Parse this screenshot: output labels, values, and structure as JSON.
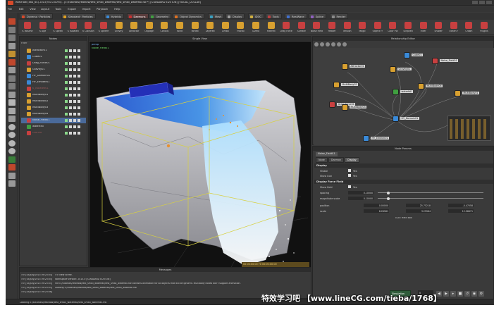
{
  "window": {
    "title": "RealFlow (x64_64) 2015(9.0.0.0095) - [E:/tutorials/realflow/test_small_waterfall/test_small_waterfall.flw *] [STANDARD EDITION] [VISUAL_DOLLAR]"
  },
  "menu": [
    "File",
    "Edit",
    "View",
    "Layout",
    "Tools",
    "Export",
    "Import",
    "Playback",
    "Help"
  ],
  "tabs": [
    {
      "label": "Dyverso · Particles",
      "color": "#d84a2a"
    },
    {
      "label": "Standard · Particles",
      "color": "#e0a020"
    },
    {
      "label": "Hybrido",
      "color": "#3a8ad8"
    },
    {
      "label": "Daemons",
      "color": "#c83030",
      "active": true
    },
    {
      "label": "Geometry",
      "color": "#40a040"
    },
    {
      "label": "Object Dynamics",
      "color": "#e07020"
    },
    {
      "label": "Mesh",
      "color": "#3aa0c0"
    },
    {
      "label": "Display",
      "color": "#a0a0a0"
    },
    {
      "label": "IDOC",
      "color": "#d0b040"
    },
    {
      "label": "Tools",
      "color": "#c04040"
    },
    {
      "label": "RealWave",
      "color": "#4070d0"
    },
    {
      "label": "Spline",
      "color": "#9060c0"
    },
    {
      "label": "Render",
      "color": "#8a8a8a"
    }
  ],
  "shelf": [
    {
      "label": "K Volume",
      "color": "#c84040"
    },
    {
      "label": "K Age",
      "color": "#c84040"
    },
    {
      "label": "K Speed",
      "color": "#c84040"
    },
    {
      "label": "K Isolated",
      "color": "#c84040"
    },
    {
      "label": "K Collision",
      "color": "#c84040"
    },
    {
      "label": "K Sphere",
      "color": "#c84040"
    },
    {
      "label": "Gravity",
      "color": "#d8a030"
    },
    {
      "label": "Attractor",
      "color": "#d8a030"
    },
    {
      "label": "Objalign",
      "color": "#d8a030"
    },
    {
      "label": "Coriolis",
      "color": "#d8a030"
    },
    {
      "label": "Wind",
      "color": "#d8a030"
    },
    {
      "label": "Vortex",
      "color": "#d8a030"
    },
    {
      "label": "Layered",
      "color": "#d8a030"
    },
    {
      "label": "Limbo",
      "color": "#d8a030"
    },
    {
      "label": "Fractal",
      "color": "#d8a030"
    },
    {
      "label": "Gizmo",
      "color": "#d8a030"
    },
    {
      "label": "Filtered",
      "color": "#d8a030"
    },
    {
      "label": "Drag Force",
      "color": "#c84040"
    },
    {
      "label": "Surface",
      "color": "#c84040"
    },
    {
      "label": "Noise Field",
      "color": "#c84040"
    },
    {
      "label": "Heater",
      "color": "#c84040"
    },
    {
      "label": "Tension",
      "color": "#c84040"
    },
    {
      "label": "Magic",
      "color": "#c84040"
    },
    {
      "label": "Object Fr",
      "color": "#c84040"
    },
    {
      "label": "Color Pla",
      "color": "#c84040"
    },
    {
      "label": "Scripted",
      "color": "#c84040"
    },
    {
      "label": "Filter",
      "color": "#c84040"
    },
    {
      "label": "Shader",
      "color": "#c84040"
    },
    {
      "label": "Ocean F",
      "color": "#c84040"
    },
    {
      "label": "Crown",
      "color": "#c84040"
    },
    {
      "label": "Plugins",
      "color": "#c84040"
    }
  ],
  "nodes_panel": {
    "title": "Nodes",
    "filter_label": "Filter",
    "items": [
      {
        "label": "Attractor01",
        "color": "#d8a030"
      },
      {
        "label": "Cube01",
        "color": "#3a8ad8"
      },
      {
        "label": "Drag_Force01",
        "color": "#c84040"
      },
      {
        "label": "Gravity01",
        "color": "#d8a030"
      },
      {
        "label": "HY_Domain01",
        "color": "#3a8ad8"
      },
      {
        "label": "HY_Emitter01",
        "color": "#3a8ad8"
      },
      {
        "label": "K_Isolated01",
        "color": "#c84040",
        "dim": true
      },
      {
        "label": "MultiBody01",
        "color": "#d8a030"
      },
      {
        "label": "MultiBody02",
        "color": "#d8a030"
      },
      {
        "label": "MultiBody03",
        "color": "#d8a030"
      },
      {
        "label": "MultiBody04",
        "color": "#d8a030"
      },
      {
        "label": "Noise_Field01",
        "color": "#c84040",
        "selected": true
      },
      {
        "label": "waterfall",
        "color": "#40a040"
      },
      {
        "label": "Ground",
        "color": "#c84040",
        "dim": true
      }
    ]
  },
  "viewport": {
    "title": "Single View",
    "label_view": "persp",
    "label_node": "Noise_Field01",
    "timecode": "00:00:00:00   F0   00:00:00:00"
  },
  "relationship_editor": {
    "title": "Relationship Editor",
    "nodes": [
      {
        "label": "Cube01",
        "color": "#3a8ad8"
      },
      {
        "label": "Attractor01",
        "color": "#d8a030"
      },
      {
        "label": "Gravity01",
        "color": "#d8a030"
      },
      {
        "label": "Noise_Field01",
        "color": "#c84040"
      },
      {
        "label": "MultiBody02",
        "color": "#d8a030"
      },
      {
        "label": "Drag_Force01",
        "color": "#c84040"
      },
      {
        "label": "waterfall",
        "color": "#40a040"
      },
      {
        "label": "MultiBody04",
        "color": "#d8a030"
      },
      {
        "label": "MultiBody03",
        "color": "#d8a030"
      },
      {
        "label": "MultiBody01",
        "color": "#d8a030"
      },
      {
        "label": "HY_Domain01",
        "color": "#3a8ad8"
      },
      {
        "label": "HY_Emitter01",
        "color": "#3a8ad8"
      }
    ]
  },
  "node_params": {
    "title": "Node Params",
    "node_name": "Noise_Field01",
    "tabs": [
      "Node",
      "Daemon",
      "Display"
    ],
    "sections": {
      "display": "Display",
      "display_force": "Display Force Field"
    },
    "rows": {
      "visible": {
        "label": "Visible",
        "value": "Yes"
      },
      "show_icon": {
        "label": "Show icon",
        "value": "Yes"
      },
      "show_field": {
        "label": "Show field",
        "value": "Yes"
      },
      "spacing": {
        "label": "spacing",
        "value": "0.10000",
        "fraction": 0.1
      },
      "magnitude": {
        "label": "magnitude scale",
        "value": "0.10000",
        "fraction": 0.1
      },
      "position": {
        "label": "position",
        "x": "0.00000",
        "y": "25.75218",
        "z": "-0.47058"
      },
      "scale": {
        "label": "scale",
        "x": "8.26961",
        "y": "3.25964",
        "z": "12.96671"
      }
    },
    "footer": "EDIT field box"
  },
  "messages": {
    "title": "Messages",
    "rows": [
      {
        "time": ">> [04/July/2015 09:25:05]",
        "msg": ">> New scene."
      },
      {
        "time": ">> [04/July/2015 09:25:05]",
        "msg": "Workspace version: 2015.0 [STANDARD EDITION]"
      },
      {
        "time": ">> [04/July/2015 09:25:05]",
        "msg": "File E:/tutorials/realflow/test_small_waterfall/test_small_waterfall.flw contains animation for all objects that will be ignored. MultiBody nodes don't support animation."
      },
      {
        "time": ">> [04/July/2015 09:25:05]",
        "msg": "Loading E:/tutorials/realflow/test_small_waterfall/test_small_waterfall.flw"
      },
      {
        "time": ">> [04/July/2015 09:25:06]",
        "msg": ""
      }
    ]
  },
  "status": {
    "text": "Loading E:/tutorials/realflow/test_small_waterfall/test_small_waterfall.flw",
    "sim_mode": "Simulation",
    "frame": "0"
  },
  "watermark": "特效学习吧 【www.lineCG.com/tieba/1768】",
  "colors": {
    "accent_red": "#c84040",
    "accent_yellow": "#d8a030",
    "accent_blue": "#3a8ad8",
    "selection": "#4a6a9a"
  }
}
